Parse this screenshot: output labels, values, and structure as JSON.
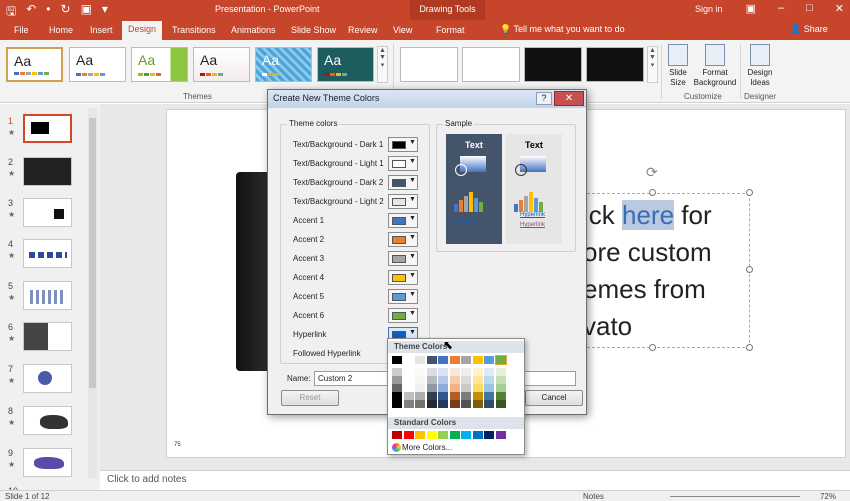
{
  "titlebar": {
    "title": "Presentation - PowerPoint",
    "contextual": "Drawing Tools",
    "signin": "Sign in",
    "qat": [
      "🖫",
      "↶",
      "•",
      "↻",
      "▣",
      "▾"
    ],
    "window_buttons": [
      "▣",
      "–",
      "□",
      "✕"
    ]
  },
  "tabs": [
    {
      "label": "File"
    },
    {
      "label": "Home"
    },
    {
      "label": "Insert"
    },
    {
      "label": "Design"
    },
    {
      "label": "Transitions"
    },
    {
      "label": "Animations"
    },
    {
      "label": "Slide Show"
    },
    {
      "label": "Review"
    },
    {
      "label": "View"
    },
    {
      "label": "Format"
    }
  ],
  "tellme": "💡 Tell me what you want to do",
  "share": "👤 Share",
  "ribbon": {
    "themes_label": "Themes",
    "customize_label": "Customize",
    "designer_label": "Designer",
    "theme_aa": "Aa",
    "slide_size": "Slide\nSize",
    "format_background": "Format\nBackground",
    "design_ideas": "Design\nIdeas"
  },
  "thumbnails": [
    "1",
    "2",
    "3",
    "4",
    "5",
    "6",
    "7",
    "8",
    "9",
    "10"
  ],
  "slide": {
    "text_lines": [
      "ick ",
      "ore custom",
      "emes from",
      "vato"
    ],
    "highlight": "here",
    "after_highlight": " for",
    "page_number": "75"
  },
  "notes_placeholder": "Click to add notes",
  "status": {
    "slide_of": "Slide 1 of 12",
    "notes": "Notes",
    "zoom": "72%"
  },
  "dialog": {
    "title": "Create New Theme Colors",
    "help": "?",
    "close": "✕",
    "theme_colors_legend": "Theme colors",
    "sample_legend": "Sample",
    "rows": [
      {
        "label": "Text/Background - Dark 1",
        "color": "#000000"
      },
      {
        "label": "Text/Background - Light 1",
        "color": "#ffffff"
      },
      {
        "label": "Text/Background - Dark 2",
        "color": "#44546a"
      },
      {
        "label": "Text/Background - Light 2",
        "color": "#e7e6e6"
      },
      {
        "label": "Accent 1",
        "color": "#4472c4"
      },
      {
        "label": "Accent 2",
        "color": "#ed7d31"
      },
      {
        "label": "Accent 3",
        "color": "#a5a5a5"
      },
      {
        "label": "Accent 4",
        "color": "#ffc000"
      },
      {
        "label": "Accent 5",
        "color": "#5b9bd5"
      },
      {
        "label": "Accent 6",
        "color": "#70ad47"
      },
      {
        "label": "Hyperlink",
        "color": "#0563c1"
      },
      {
        "label": "Followed Hyperlink",
        "color": "#954f72"
      }
    ],
    "sample_text": "Text",
    "sample_hyperlink": "Hyperlink",
    "name_label": "Name:",
    "name_value": "Custom 2",
    "reset": "Reset",
    "cancel": "Cancel"
  },
  "color_picker": {
    "theme_colors_label": "Theme Colors",
    "standard_colors_label": "Standard Colors",
    "more_colors": "More Colors...",
    "theme_top": [
      "#000000",
      "#ffffff",
      "#e7e6e6",
      "#44546a",
      "#4472c4",
      "#ed7d31",
      "#a5a5a5",
      "#ffc000",
      "#5b9bd5",
      "#70ad47",
      "#0563c1",
      "#954f72"
    ],
    "standard": [
      "#c00000",
      "#ff0000",
      "#ffc000",
      "#ffff00",
      "#92d050",
      "#00b050",
      "#00b0f0",
      "#0070c0",
      "#002060",
      "#7030a0"
    ]
  }
}
